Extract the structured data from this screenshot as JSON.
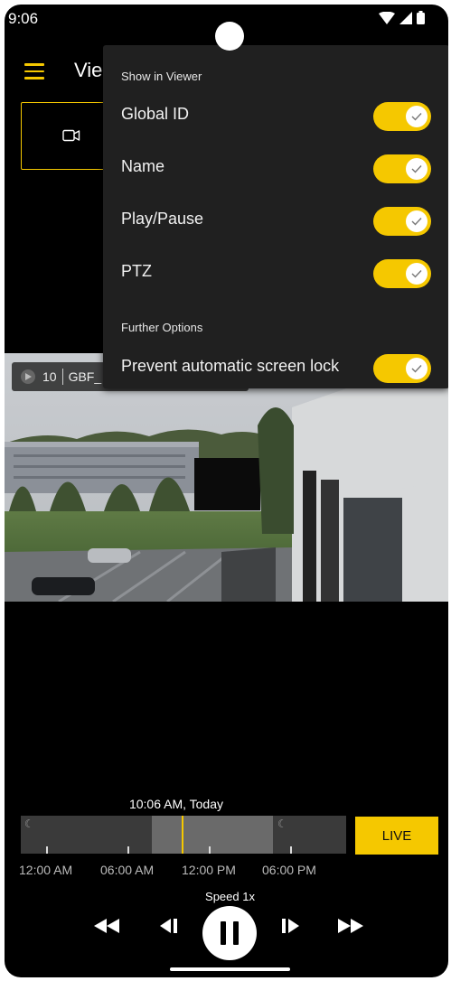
{
  "status_bar": {
    "time": "9:06",
    "icons": [
      "wifi-icon",
      "signal-icon",
      "battery-icon"
    ]
  },
  "app_bar": {
    "title": "Vie",
    "menu_icon": "menu-icon"
  },
  "camera_tile": {
    "icon": "camera-icon"
  },
  "video": {
    "overlay_channel": "10",
    "overlay_name": "GBF_"
  },
  "viewer_menu": {
    "section_show": "Show in Viewer",
    "items": [
      {
        "label": "Global ID",
        "on": true
      },
      {
        "label": "Name",
        "on": true
      },
      {
        "label": "Play/Pause",
        "on": true
      },
      {
        "label": "PTZ",
        "on": true
      }
    ],
    "section_further": "Further Options",
    "further_items": [
      {
        "label": "Prevent automatic screen lock",
        "on": true
      }
    ]
  },
  "timeline": {
    "timestamp": "10:06 AM, Today",
    "live_label": "LIVE",
    "tick_labels": [
      "12:00 AM",
      "06:00 AM",
      "12:00 PM",
      "06:00 PM"
    ]
  },
  "playback": {
    "speed_label": "Speed 1x",
    "controls": [
      "fast-rewind-icon",
      "step-back-icon",
      "pause-icon",
      "step-forward-icon",
      "fast-forward-icon"
    ]
  },
  "colors": {
    "accent": "#f5c800",
    "menu_bg": "#202020",
    "background": "#000000"
  }
}
